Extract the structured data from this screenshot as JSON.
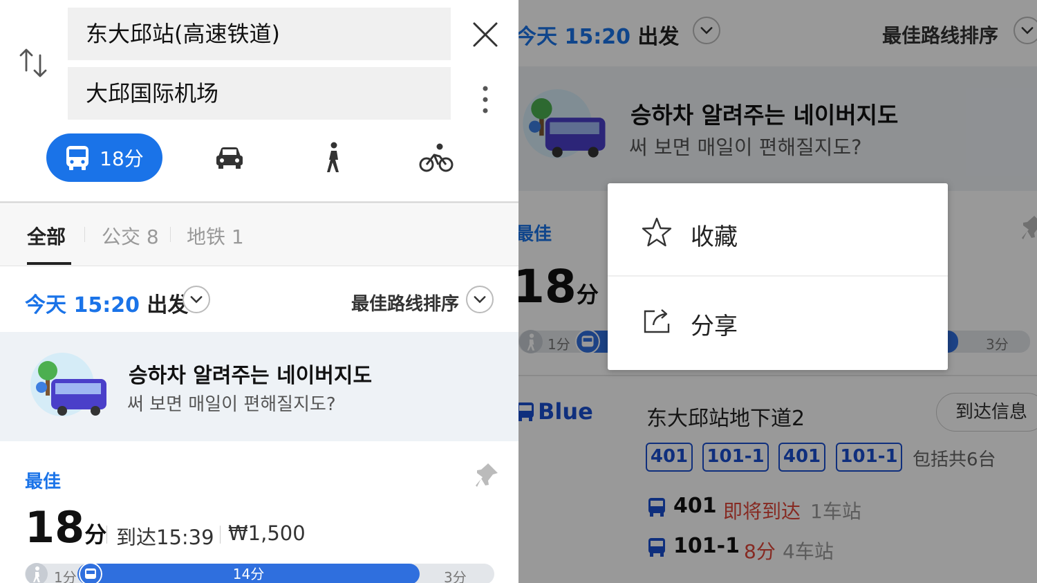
{
  "search": {
    "origin": "东大邱站(高速铁道)",
    "destination": "大邱国际机场"
  },
  "modes": {
    "transit_time": "18分",
    "active": "transit"
  },
  "filters": [
    {
      "label": "全部"
    },
    {
      "label": "公交 8"
    },
    {
      "label": "地铁 1"
    }
  ],
  "depart": {
    "time": "今天 15:20",
    "word": "出发",
    "sort_label": "最佳路线排序"
  },
  "ad": {
    "title": "승하차 알려주는 네이버지도",
    "subtitle": "써 보면 매일이 편해질지도?"
  },
  "best_route": {
    "badge": "最佳",
    "minutes": "18",
    "unit": "分",
    "arrive": "到达15:39",
    "fare": "₩1,500",
    "walk1": "1分",
    "bus_segment": "14分",
    "walk2": "3分",
    "bus_progress_fraction": 0.78
  },
  "right": {
    "bus_line": "Blue",
    "stop_name": "东大邱站地下道2",
    "arrive_info": "到达信息",
    "chips": [
      "401",
      "101-1",
      "401",
      "101-1"
    ],
    "chip_note": "包括共6台",
    "arrivals": [
      {
        "bus": "401",
        "status": "即将到达",
        "stops": "1车站"
      },
      {
        "bus": "101-1",
        "status": "8分",
        "stops": "4车站"
      }
    ]
  },
  "menu": {
    "favorite": "收藏",
    "share": "分享"
  },
  "colors": {
    "accent": "#1a73e8",
    "bus_line": "#1a4fd0",
    "alert": "#e0463a"
  }
}
